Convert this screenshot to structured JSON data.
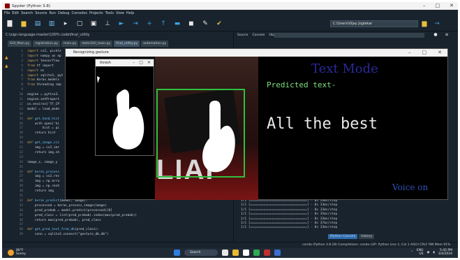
{
  "window": {
    "title": "Spyder (Python 3.8)"
  },
  "menu": [
    "File",
    "Edit",
    "Search",
    "Source",
    "Run",
    "Debug",
    "Consoles",
    "Projects",
    "Tools",
    "View",
    "Help"
  ],
  "toolbar": {
    "path": "C:\\Users\\Vijay Joglekar"
  },
  "editor": {
    "file_path": "C:\\sign-language-master\\100% code\\final_utility",
    "tabs": [
      "GUI_Main.py",
      "registration.py",
      "main.py",
      "staticGUI_main.py",
      "final_utility.py",
      "automation.py"
    ],
    "active_tab": 4,
    "lines": [
      {
        "n": "1",
        "parts": [
          {
            "t": "import ",
            "c": "kw"
          },
          {
            "t": "cv2, pickle"
          }
        ]
      },
      {
        "n": "2",
        "parts": [
          {
            "t": "import ",
            "c": "kw"
          },
          {
            "t": "numpy as np"
          }
        ]
      },
      {
        "n": "3",
        "parts": [
          {
            "t": "import ",
            "c": "kw"
          },
          {
            "t": "tensorflow"
          }
        ]
      },
      {
        "n": "4",
        "parts": [
          {
            "t": "from ",
            "c": "kw"
          },
          {
            "t": "tf import"
          }
        ]
      },
      {
        "n": "5",
        "parts": [
          {
            "t": "import ",
            "c": "kw"
          },
          {
            "t": "os"
          }
        ]
      },
      {
        "n": "6",
        "parts": [
          {
            "t": "import ",
            "c": "kw"
          },
          {
            "t": "sqlite3, pyt"
          }
        ]
      },
      {
        "n": "7",
        "parts": [
          {
            "t": "from ",
            "c": "kw"
          },
          {
            "t": "keras.models"
          }
        ]
      },
      {
        "n": "8",
        "parts": [
          {
            "t": "from ",
            "c": "kw"
          },
          {
            "t": "threading imp"
          }
        ]
      },
      {
        "n": "9",
        "parts": []
      },
      {
        "n": "10",
        "parts": [
          {
            "t": "engine = pyttsx3."
          }
        ]
      },
      {
        "n": "11",
        "parts": [
          {
            "t": "engine.setPropert"
          }
        ]
      },
      {
        "n": "12",
        "parts": [
          {
            "t": "os.environ['TF_CP"
          }
        ]
      },
      {
        "n": "13",
        "parts": [
          {
            "t": "model = load_mode"
          }
        ]
      },
      {
        "n": "14",
        "parts": []
      },
      {
        "n": "15",
        "parts": [
          {
            "t": "def ",
            "c": "kw"
          },
          {
            "t": "get_hand_hist",
            "c": "fn"
          }
        ]
      },
      {
        "n": "16",
        "parts": [
          {
            "t": "    with open('hi"
          }
        ]
      },
      {
        "n": "17",
        "parts": [
          {
            "t": "        hist = pi"
          }
        ]
      },
      {
        "n": "18",
        "parts": [
          {
            "t": "    return hist"
          }
        ]
      },
      {
        "n": "19",
        "parts": []
      },
      {
        "n": "20",
        "parts": [
          {
            "t": "def ",
            "c": "kw"
          },
          {
            "t": "get_image_siz",
            "c": "fn"
          }
        ]
      },
      {
        "n": "21",
        "parts": [
          {
            "t": "    img = cv2.imr"
          }
        ]
      },
      {
        "n": "22",
        "parts": [
          {
            "t": "    return img.sh"
          }
        ]
      },
      {
        "n": "23",
        "parts": []
      },
      {
        "n": "24",
        "parts": [
          {
            "t": "image_x, image_y"
          }
        ]
      },
      {
        "n": "25",
        "parts": []
      },
      {
        "n": "26",
        "parts": [
          {
            "t": "def ",
            "c": "kw"
          },
          {
            "t": "keras_process",
            "c": "fn"
          }
        ]
      },
      {
        "n": "27",
        "parts": [
          {
            "t": "    img = cv2.res"
          }
        ]
      },
      {
        "n": "28",
        "parts": [
          {
            "t": "    img = np.arra"
          }
        ]
      },
      {
        "n": "29",
        "parts": [
          {
            "t": "    img = np.resh"
          }
        ]
      },
      {
        "n": "30",
        "parts": [
          {
            "t": "    return img"
          }
        ]
      },
      {
        "n": "31",
        "parts": []
      },
      {
        "n": "32",
        "parts": [
          {
            "t": "def ",
            "c": "kw"
          },
          {
            "t": "keras_predict",
            "c": "fn"
          },
          {
            "t": "(model, image):"
          }
        ]
      },
      {
        "n": "33",
        "parts": [
          {
            "t": "    processed = keras_process_image(image)"
          }
        ]
      },
      {
        "n": "34",
        "parts": [
          {
            "t": "    pred_probab = model.predict(processed)[0]"
          }
        ]
      },
      {
        "n": "35",
        "parts": [
          {
            "t": "    pred_class = list(pred_probab).index(max(pred_probab))"
          }
        ]
      },
      {
        "n": "36",
        "parts": [
          {
            "t": "    return max(pred_probab), pred_class"
          }
        ]
      },
      {
        "n": "37",
        "parts": []
      },
      {
        "n": "38",
        "parts": [
          {
            "t": "def ",
            "c": "kw"
          },
          {
            "t": "get_pred_text_from_db",
            "c": "fn"
          },
          {
            "t": "(pred_class):"
          }
        ]
      },
      {
        "n": "39",
        "parts": [
          {
            "t": "    conn = sqlite3.connect(\"gesture_db.db\")"
          }
        ]
      }
    ]
  },
  "right_panel": {
    "tabs": [
      "Source",
      "Console",
      "Object"
    ],
    "console_lines": [
      "1/1 [==============================] - 0s 29ms/step",
      "1/1 [==============================] - 0s 33ms/step",
      "1/1 [==============================] - 0s 33ms/step",
      "1/1 [==============================] - 0s 35ms/step",
      "1/1 [==============================] - 0s 33ms/step",
      "1/1 [==============================] - 0s 37ms/step",
      "1/1 [==============================] - 0s 33ms/step"
    ],
    "bottom_tabs": [
      "IPython Console",
      "History"
    ]
  },
  "status_bar": {
    "text": "conda (Python 3.8.18)    Completions: conda    LSP: Python    Line 1, Col 1    ASCII    CRLF    RW    Mem 91%"
  },
  "taskbar": {
    "temp": "86°F",
    "weather": "Sunny",
    "search": "Search",
    "lang1": "ENG",
    "lang2": "US",
    "time": "5:45 PM",
    "date": "3/4/2024"
  },
  "gesture_window": {
    "title": "Recognizing gesture",
    "text_mode": "Text Mode",
    "predicted_label": "Predicted text-",
    "predicted_text": "All the best",
    "voice": "Voice on",
    "lettering": "LIAI"
  },
  "thresh_window": {
    "title": "thresh"
  },
  "colors": {
    "roi_box": "#2fbf3f",
    "text_mode": "#2a2a9a",
    "predicted_label": "#7fe07f",
    "voice": "#2f52b6"
  }
}
